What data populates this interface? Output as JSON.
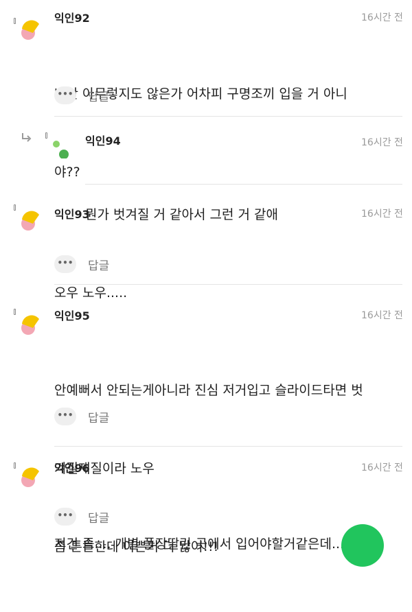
{
  "comments": [
    {
      "author": "익인92",
      "time": "16시간 전",
      "lines": [
        "나만 아무렇지도 않은가 어차피 구명조끼 입을 거 아니",
        "야??"
      ],
      "more_label": "•••",
      "reply_label": "답글",
      "avatar": "yellow-pink-avatar-icon"
    },
    {
      "author": "익인94",
      "time": "16시간 전",
      "lines": [
        "뭔가 벗겨질 거 같아서 그런 거 같애"
      ],
      "avatar": "green-dots-avatar-icon",
      "is_reply": true
    },
    {
      "author": "익인93",
      "time": "16시간 전",
      "lines": [
        "오우 노우....."
      ],
      "more_label": "•••",
      "reply_label": "답글",
      "avatar": "yellow-pink-avatar-icon"
    },
    {
      "author": "익인95",
      "time": "16시간 전",
      "lines": [
        "안예뻐서 안되는게아니라 진심 저거입고 슬라이드타면 벗",
        "겨질재질이라 노우",
        "좀 튼튼한데 이쁜거 더 많어!!!"
      ],
      "more_label": "•••",
      "reply_label": "답글",
      "avatar": "yellow-pink-avatar-icon"
    },
    {
      "author": "익인96",
      "time": "16시간 전",
      "lines": [
        "저건 좀.... 개별 풀장딸린 곳에서 입어야할거같은데..."
      ],
      "more_label": "•••",
      "reply_label": "답글",
      "avatar": "yellow-pink-avatar-icon"
    }
  ],
  "colors": {
    "avatar_yellow": "#f5c400",
    "avatar_pink": "#f3a7b4",
    "avatar_green": "#4caf50",
    "avatar_green_light": "#8bd36a",
    "fab_green": "#21c55d"
  }
}
